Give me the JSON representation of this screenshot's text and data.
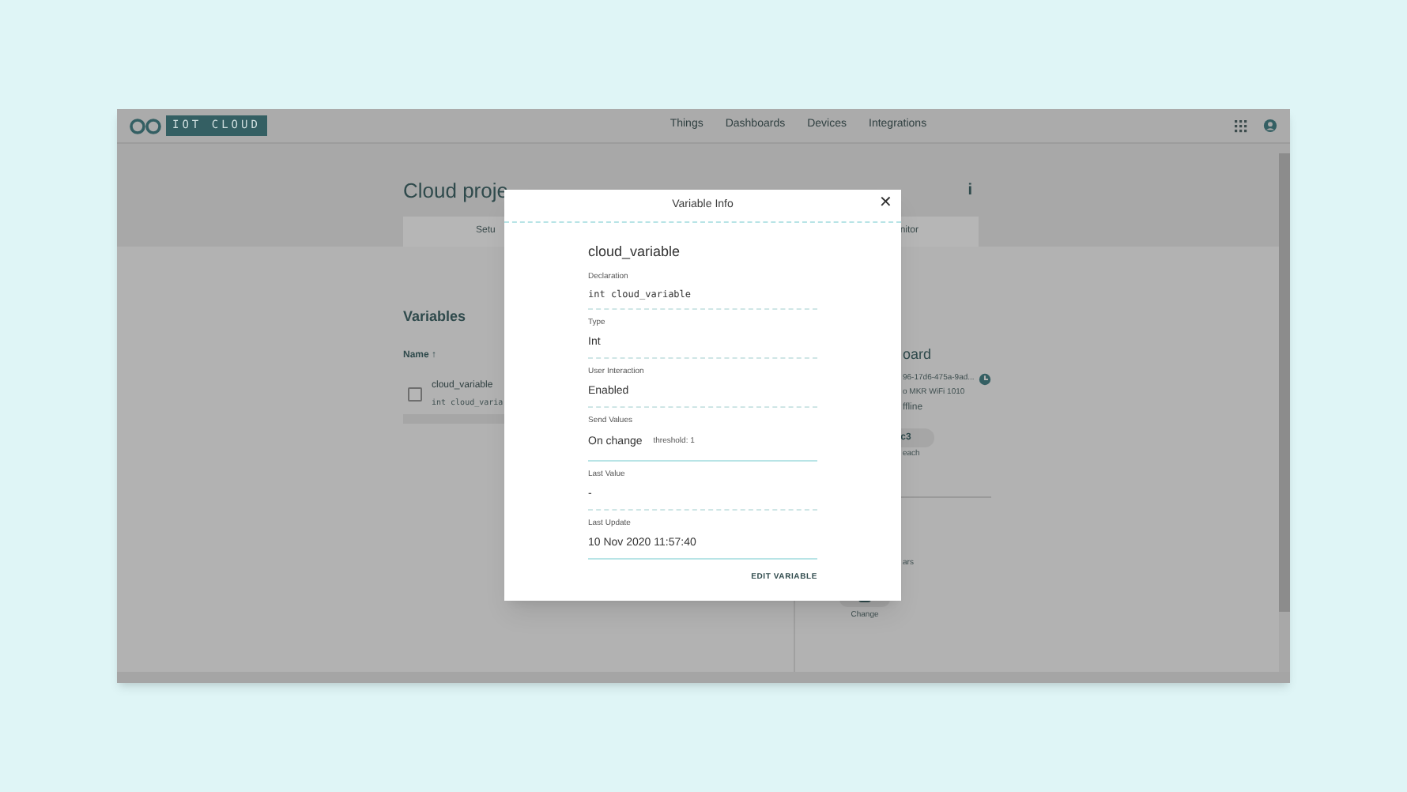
{
  "nav": {
    "logo_text": "IOT CLOUD",
    "links": [
      "Things",
      "Dashboards",
      "Devices",
      "Integrations"
    ]
  },
  "header": {
    "title": "Cloud proje",
    "info_glyph": "i",
    "tabs": [
      "Setu",
      "nitor"
    ]
  },
  "variables": {
    "heading": "Variables",
    "sort_column": "Name ↑",
    "rows": [
      {
        "name": "cloud_variable",
        "declaration": "int cloud_varia",
        "checked": false
      }
    ]
  },
  "device": {
    "heading": "oard",
    "id": "96-17d6-475a-9ad...",
    "type": "o MKR WiFi 1010",
    "status": "ffline",
    "badge": "c3",
    "badge_caption": "each",
    "line_1": "ars",
    "change_label": "Change"
  },
  "modal": {
    "title": "Variable Info",
    "close_glyph": "✕",
    "name": "cloud_variable",
    "fields": [
      {
        "label": "Declaration",
        "value": "int cloud_variable",
        "kind": "code"
      },
      {
        "label": "Type",
        "value": "Int",
        "kind": "text"
      },
      {
        "label": "User Interaction",
        "value": "Enabled",
        "kind": "text"
      },
      {
        "label": "Send Values",
        "value": "On change",
        "note": "threshold: 1",
        "kind": "note"
      },
      {
        "label": "Last Value",
        "value": "-",
        "kind": "text"
      },
      {
        "label": "Last Update",
        "value": "10 Nov 2020 11:57:40",
        "kind": "text"
      }
    ],
    "action": "EDIT VARIABLE"
  }
}
